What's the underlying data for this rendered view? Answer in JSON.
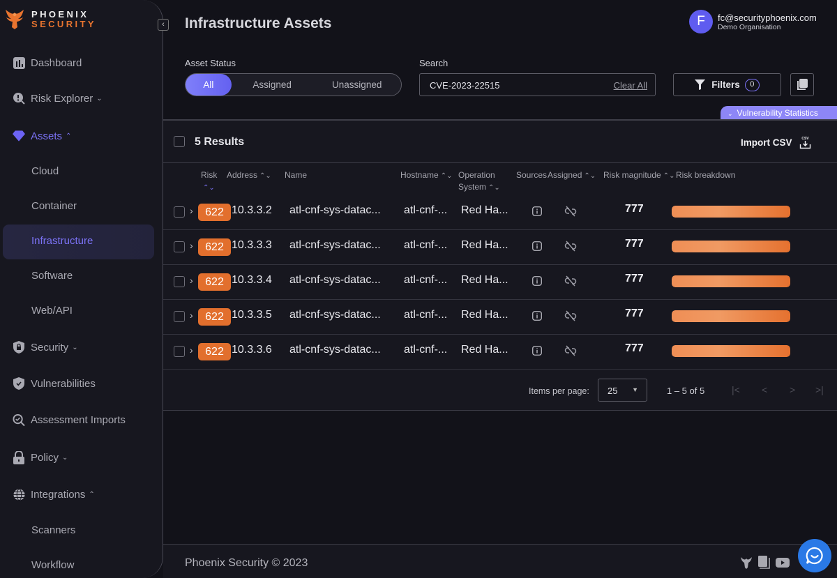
{
  "brand": {
    "line1": "PHOENIX",
    "line2": "SECURITY"
  },
  "sidebar": {
    "collapse_icon": "chevron-left",
    "items": [
      {
        "label": "Dashboard",
        "icon": "bar-chart-icon"
      },
      {
        "label": "Risk Explorer",
        "icon": "alert-search-icon",
        "chevron": "⌄"
      },
      {
        "label": "Assets",
        "icon": "diamond-icon",
        "chevron": "⌃",
        "active": true
      },
      {
        "label": "Security",
        "icon": "shield-lock-icon",
        "chevron": "⌄"
      },
      {
        "label": "Vulnerabilities",
        "icon": "shield-check-icon"
      },
      {
        "label": "Assessment Imports",
        "icon": "search-check-icon"
      },
      {
        "label": "Policy",
        "icon": "lock-icon",
        "chevron": "⌄"
      },
      {
        "label": "Integrations",
        "icon": "globe-icon",
        "chevron": "⌃"
      }
    ],
    "asset_subitems": [
      "Cloud",
      "Container",
      "Infrastructure",
      "Software",
      "Web/API"
    ],
    "integration_subitems": [
      "Scanners",
      "Workflow"
    ],
    "active_subitem": "Infrastructure"
  },
  "header": {
    "title": "Infrastructure Assets",
    "user": {
      "initial": "F",
      "email": "fc@securityphoenix.com",
      "org": "Demo Organisation"
    }
  },
  "filters": {
    "asset_status_label": "Asset Status",
    "segments": [
      "All",
      "Assigned",
      "Unassigned"
    ],
    "selected_segment": "All",
    "search_label": "Search",
    "search_value": "CVE-2023-22515",
    "clear_all": "Clear All",
    "filters_label": "Filters",
    "filters_count": "0",
    "vuln_stats_label": "Vulnerability Statistics"
  },
  "table": {
    "results_label": "5 Results",
    "import_csv": "Import CSV",
    "csv_icon_text": "CSV",
    "columns": {
      "risk": "Risk",
      "address": "Address",
      "name": "Name",
      "hostname": "Hostname",
      "os_line1": "Operation",
      "os_line2": "System",
      "sources": "Sources",
      "assigned": "Assigned",
      "risk_magnitude": "Risk magnitude",
      "risk_breakdown": "Risk breakdown"
    },
    "rows": [
      {
        "risk": "622",
        "address": "10.3.3.2",
        "name": "atl-cnf-sys-datac...",
        "hostname": "atl-cnf-...",
        "os": "Red Ha...",
        "magnitude": "777",
        "breakdown_pct": 100
      },
      {
        "risk": "622",
        "address": "10.3.3.3",
        "name": "atl-cnf-sys-datac...",
        "hostname": "atl-cnf-...",
        "os": "Red Ha...",
        "magnitude": "777",
        "breakdown_pct": 100
      },
      {
        "risk": "622",
        "address": "10.3.3.4",
        "name": "atl-cnf-sys-datac...",
        "hostname": "atl-cnf-...",
        "os": "Red Ha...",
        "magnitude": "777",
        "breakdown_pct": 100
      },
      {
        "risk": "622",
        "address": "10.3.3.5",
        "name": "atl-cnf-sys-datac...",
        "hostname": "atl-cnf-...",
        "os": "Red Ha...",
        "magnitude": "777",
        "breakdown_pct": 100
      },
      {
        "risk": "622",
        "address": "10.3.3.6",
        "name": "atl-cnf-sys-datac...",
        "hostname": "atl-cnf-...",
        "os": "Red Ha...",
        "magnitude": "777",
        "breakdown_pct": 100
      }
    ],
    "pagination": {
      "items_per_page_label": "Items per page:",
      "items_per_page": "25",
      "range": "1 – 5 of 5",
      "first": "|<",
      "prev": "<",
      "next": ">",
      "last": ">|"
    }
  },
  "footer": {
    "copyright": "Phoenix Security © 2023"
  },
  "colors": {
    "accent": "#7b72f5",
    "risk": "#e26f2d",
    "chat": "#2a79e6"
  }
}
